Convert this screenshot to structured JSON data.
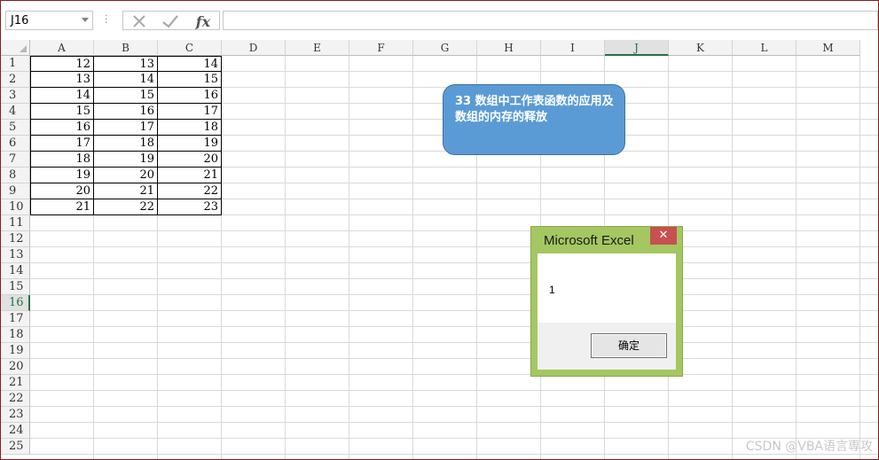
{
  "namebox": {
    "value": "J16"
  },
  "formula_bar": {
    "cancel_icon": "x-icon",
    "enter_icon": "check-icon",
    "fx_label": "fx",
    "content": ""
  },
  "columns": [
    "A",
    "B",
    "C",
    "D",
    "E",
    "F",
    "G",
    "H",
    "I",
    "J",
    "K",
    "L",
    "M"
  ],
  "selected_column": "J",
  "rows": [
    "1",
    "2",
    "3",
    "4",
    "5",
    "6",
    "7",
    "8",
    "9",
    "10",
    "11",
    "12",
    "13",
    "14",
    "15",
    "16",
    "17",
    "18",
    "19",
    "20",
    "21",
    "22",
    "23",
    "24",
    "25"
  ],
  "selected_row": "16",
  "cells": [
    [
      "12",
      "13",
      "14"
    ],
    [
      "13",
      "14",
      "15"
    ],
    [
      "14",
      "15",
      "16"
    ],
    [
      "15",
      "16",
      "17"
    ],
    [
      "16",
      "17",
      "18"
    ],
    [
      "17",
      "18",
      "19"
    ],
    [
      "18",
      "19",
      "20"
    ],
    [
      "19",
      "20",
      "21"
    ],
    [
      "20",
      "21",
      "22"
    ],
    [
      "21",
      "22",
      "23"
    ]
  ],
  "shape": {
    "text": "33  数组中工作表函数的应用及数组的内存的释放",
    "fill": "#5b9bd5"
  },
  "msgbox": {
    "title": "Microsoft Excel",
    "close_label": "✕",
    "message": "1",
    "ok_label": "确定",
    "frame_color": "#a4c762"
  },
  "watermark": "CSDN @VBA语言専攻"
}
